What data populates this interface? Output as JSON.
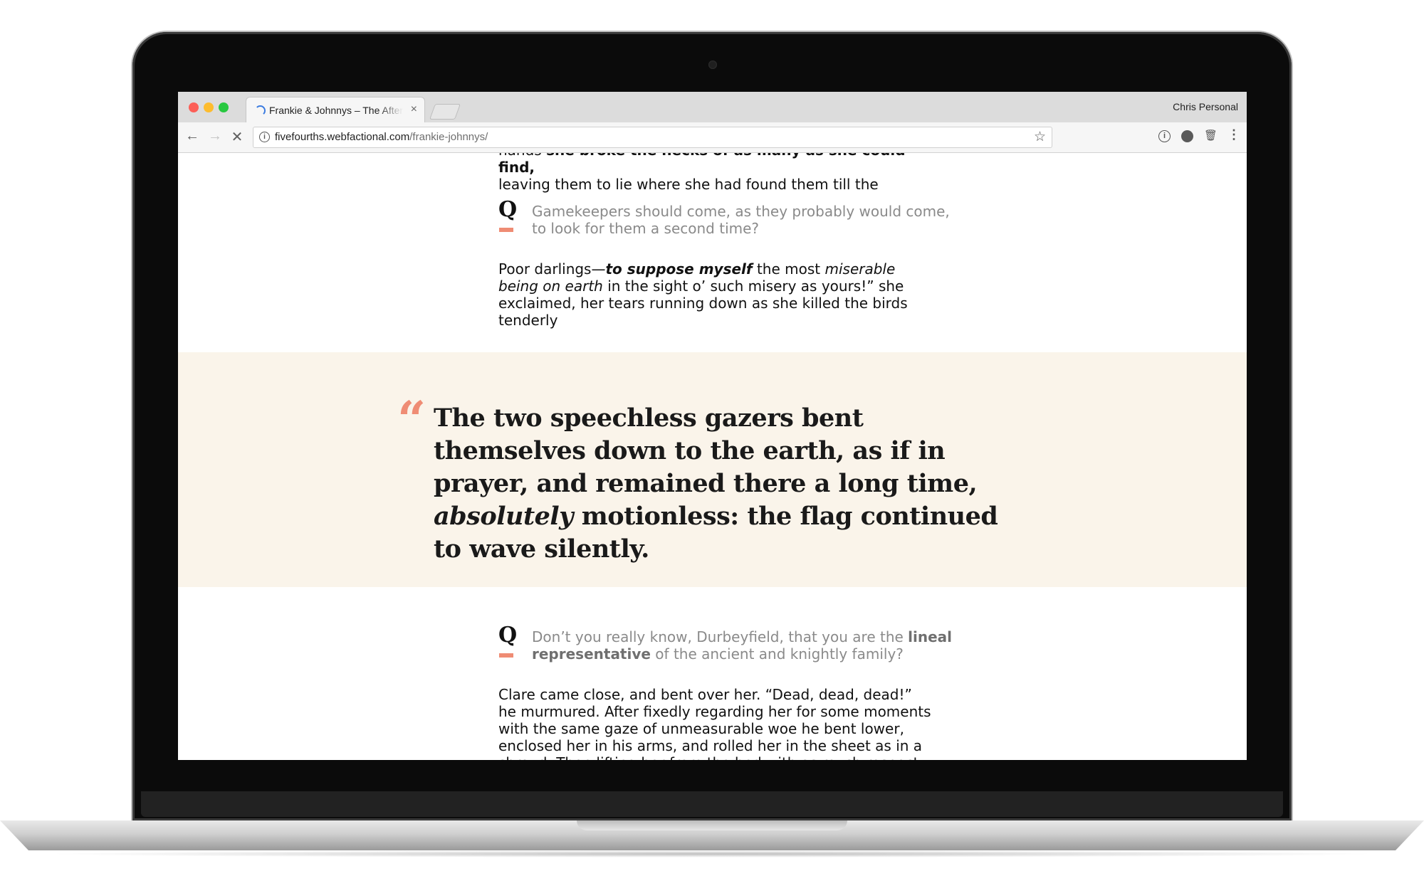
{
  "browser": {
    "tab_title": "Frankie & Johnnys – The Afternoon",
    "tab_close": "×",
    "profile_name": "Chris Personal",
    "url_host": "fivefourths.webfactional.com",
    "url_path": "/frankie-johnnys/",
    "icons": {
      "back": "arrow-left",
      "forward": "arrow-right",
      "stop": "close-x",
      "site_info": "info-circle",
      "bookmark": "star-outline",
      "extension_1": "info-circle",
      "extension_2": "shield",
      "extension_3": "trash",
      "menu": "vertical-dots"
    }
  },
  "page": {
    "top_para_prefix": "hands ",
    "top_para_bold": "she broke the necks of as many as she could find,",
    "top_para_rest": "leaving them to lie where she had found them till the",
    "q_label": "Q",
    "q1_text": "Gamekeepers should come, as they probably would come, to look for them a second time?",
    "para2_a": "Poor darlings—",
    "para2_bolditalic": "to suppose myself",
    "para2_b": " the most ",
    "para2_italic": "miserable being on earth",
    "para2_c": " in the sight o’ such misery as yours!” she exclaimed, her tears running down as she killed the birds tenderly",
    "quote_mark": "“",
    "pull_quote_a": "The two speechless gazers bent themselves down to the earth, as if in prayer, and remained there a long time, ",
    "pull_quote_italic": "absolutely",
    "pull_quote_b": " motionless: the flag continued to wave silently.",
    "q2_a": "Don’t you really know, Durbeyfield, that you are the ",
    "q2_bold": "lineal representative",
    "q2_b": " of the ancient and knightly family?",
    "para3": "Clare came close, and bent over her. “Dead, dead, dead!” he murmured. After fixedly regarding her for some moments with the same gaze of unmeasurable woe he bent lower, enclosed her in his arms, and rolled her in the sheet as in a shroud. Then lifting her from the bed with as much respect as one"
  },
  "colors": {
    "accent": "#ef8c74",
    "band": "#faf4ea",
    "muted_text": "#8a8a8a"
  }
}
